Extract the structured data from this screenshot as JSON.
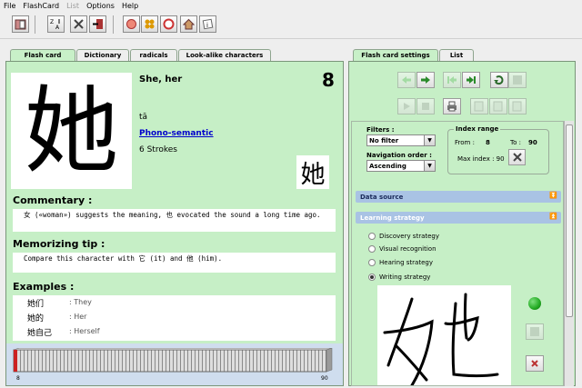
{
  "menu": [
    "File",
    "FlashCard",
    "List",
    "Options",
    "Help"
  ],
  "left_tabs": [
    "Flash card",
    "Dictionary",
    "radicals",
    "Look-alike characters"
  ],
  "right_tabs": [
    "Flash card settings",
    "List"
  ],
  "card": {
    "character": "她",
    "number": "8",
    "meaning": "She, her",
    "pinyin": "tā",
    "type_link": "Phono-semantic",
    "strokes": "6 Strokes",
    "commentary_title": "Commentary :",
    "commentary_text": "女 («woman») suggests the meaning, 也 evocated the sound a long time ago.",
    "tip_title": "Memorizing tip :",
    "tip_text": "Compare this character with 它 (it) and 他 (him).",
    "examples_title": "Examples :",
    "examples": [
      {
        "word": "她们",
        "meaning": ": They"
      },
      {
        "word": "她的",
        "meaning": ": Her"
      },
      {
        "word": "她自己",
        "meaning": ": Herself"
      }
    ]
  },
  "ruler": {
    "start": "8",
    "end": "90",
    "current_fraction": 0.0
  },
  "settings": {
    "filters_label": "Filters :",
    "filter_value": "No filter",
    "order_label": "Navigation order :",
    "order_value": "Ascending",
    "index_range_label": "Index range",
    "from_label": "From :",
    "from_value": "8",
    "to_label": "To :",
    "to_value": "90",
    "max_index_label": "Max index : 90",
    "data_source_label": "Data source",
    "learning_strategy_label": "Learning strategy",
    "strategies": [
      "Discovery strategy",
      "Visual recognition",
      "Hearing strategy",
      "Writing strategy"
    ],
    "selected_strategy": 3
  },
  "colors": {
    "panel_green": "#c6efc6",
    "section_blue": "#a9c3e4",
    "link": "#0000cc",
    "status_green": "#22aa22"
  }
}
